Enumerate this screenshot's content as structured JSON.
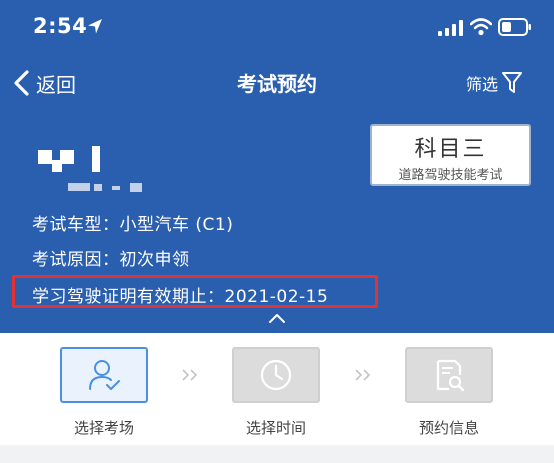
{
  "status_bar": {
    "time": "2:54",
    "location_icon": "location-arrow-icon",
    "signal_icon": "cellular-signal-icon",
    "wifi_icon": "wifi-icon",
    "battery_icon": "battery-icon"
  },
  "nav": {
    "back_label": "返回",
    "back_icon": "chevron-left-icon",
    "title": "考试预约",
    "filter_label": "筛选",
    "filter_icon": "funnel-icon"
  },
  "subject": {
    "title": "科目三",
    "subtitle": "道路驾驶技能考试"
  },
  "info": {
    "vehicle_type": "考试车型：小型汽车 (C1)",
    "reason": "考试原因：初次申领",
    "permit_expiry": "学习驾驶证明有效期止：2021-02-15"
  },
  "steps": [
    {
      "label": "选择考场",
      "icon": "user-check-icon",
      "state": "active"
    },
    {
      "label": "选择时间",
      "icon": "clock-icon",
      "state": "inactive"
    },
    {
      "label": "预约信息",
      "icon": "document-search-icon",
      "state": "inactive"
    }
  ],
  "colors": {
    "header_bg": "#2a5fb0",
    "highlight_border": "#e33232",
    "active_step_border": "#4a90e2"
  }
}
